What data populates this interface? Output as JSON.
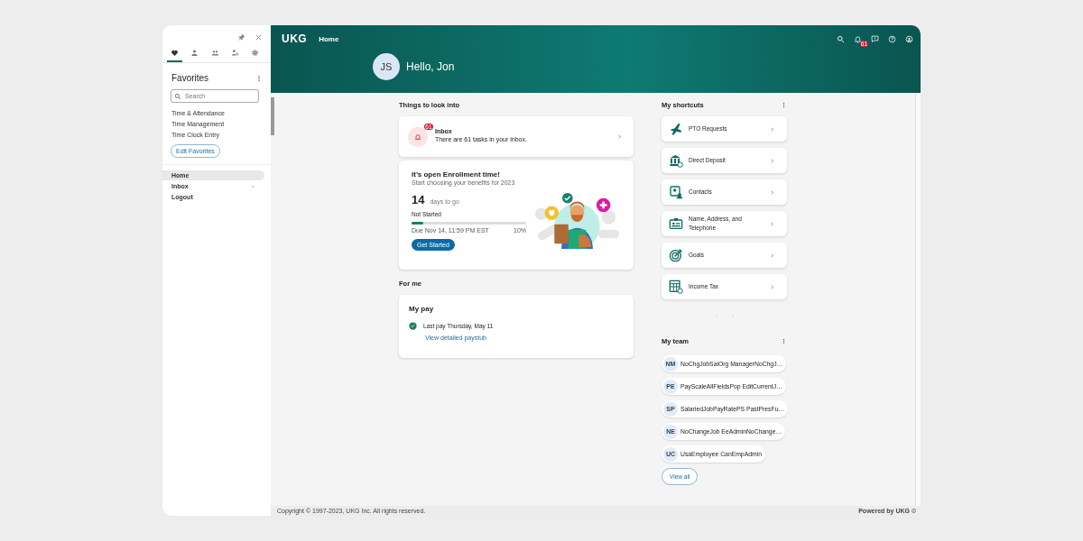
{
  "sidebar": {
    "tabs": [
      {
        "kind": "heart",
        "selected": true
      },
      {
        "kind": "person",
        "selected": false
      },
      {
        "kind": "people",
        "selected": false
      },
      {
        "kind": "person-gear",
        "selected": false
      },
      {
        "kind": "gear",
        "selected": false
      }
    ],
    "title": "Favorites",
    "search": {
      "placeholder": "Search"
    },
    "favorites": [
      "Time & Attendance",
      "Time Management",
      "Time Clock Entry"
    ],
    "edit_button": "Edit Favorites",
    "nav": [
      {
        "label": "Home",
        "selected": true,
        "expandable": false
      },
      {
        "label": "Inbox",
        "selected": false,
        "expandable": true
      },
      {
        "label": "Logout",
        "selected": false,
        "expandable": false
      }
    ]
  },
  "header": {
    "logo": "UKG",
    "page": "Home",
    "notification_count": "61",
    "avatar": "JS",
    "greeting": "Hello, Jon"
  },
  "things": {
    "title": "Things to look into",
    "inbox": {
      "title": "Inbox",
      "text": "There are 61 tasks in your inbox.",
      "badge": "61"
    },
    "enrollment": {
      "title": "It’s open Enrollment time!",
      "subtitle": "Start choosing your benefits for 2023",
      "days": "14",
      "days_label": "days to go",
      "status": "Not Started",
      "level": 0.1,
      "due": "Due Nov 14, 11:59 PM EST",
      "percent": "10%",
      "button": "Get Started"
    }
  },
  "for_me": {
    "title": "For me",
    "pay": {
      "title": "My pay",
      "text": "Last pay Thursday, May 11",
      "link": "View detailed paystub"
    }
  },
  "shortcuts": {
    "title": "My shortcuts",
    "items": [
      {
        "label": "PTO Requests",
        "kind": "plane"
      },
      {
        "label": "Direct Deposit",
        "kind": "bank"
      },
      {
        "label": "Contacts",
        "kind": "contacts"
      },
      {
        "label": "Name, Address, and Telephone",
        "kind": "id-card"
      },
      {
        "label": "Goals",
        "kind": "target"
      },
      {
        "label": "Income Tax",
        "kind": "calculator"
      }
    ]
  },
  "team": {
    "title": "My team",
    "members": [
      {
        "initials": "NM",
        "name": "NoChgJobSalOrg ManagerNoChgJ…"
      },
      {
        "initials": "PE",
        "name": "PayScaleAllFieldsPop EditCurrentJ…"
      },
      {
        "initials": "SP",
        "name": "SalariedJobPayRatePS PastPresFu…"
      },
      {
        "initials": "NE",
        "name": "NoChangeJob EeAdminNoChange…"
      },
      {
        "initials": "UC",
        "name": "UsaEmployee CanEmpAdmin"
      }
    ],
    "button": "View all"
  },
  "footer": {
    "copyright": "Copyright © 1997-2023, UKG Inc. All rights reserved.",
    "powered": "Powered by UKG"
  }
}
